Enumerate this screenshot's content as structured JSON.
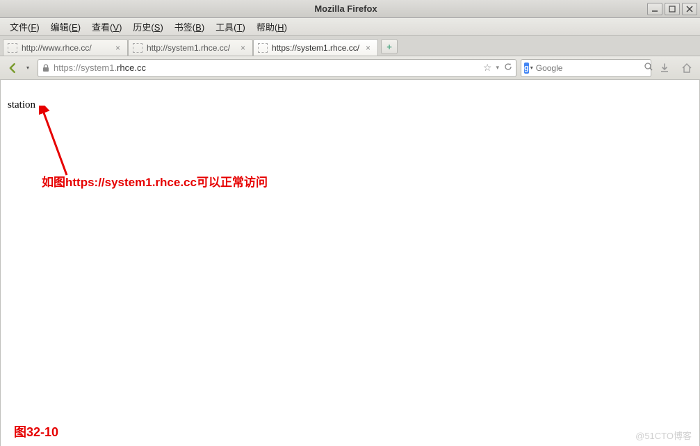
{
  "window": {
    "title": "Mozilla Firefox"
  },
  "menu": {
    "file": {
      "label": "文件",
      "accel": "F"
    },
    "edit": {
      "label": "编辑",
      "accel": "E"
    },
    "view": {
      "label": "查看",
      "accel": "V"
    },
    "history": {
      "label": "历史",
      "accel": "S"
    },
    "bookmarks": {
      "label": "书签",
      "accel": "B"
    },
    "tools": {
      "label": "工具",
      "accel": "T"
    },
    "help": {
      "label": "帮助",
      "accel": "H"
    }
  },
  "tabs": [
    {
      "label": "http://www.rhce.cc/",
      "active": false
    },
    {
      "label": "http://system1.rhce.cc/",
      "active": false
    },
    {
      "label": "https://system1.rhce.cc/",
      "active": true
    }
  ],
  "newtab_symbol": "+",
  "url": {
    "prefix": "https://",
    "domain": "system1.",
    "suffix": "rhce.cc"
  },
  "search": {
    "engine_letter": "g",
    "placeholder": "Google"
  },
  "page": {
    "body_text": "station"
  },
  "annotation": {
    "text": "如图https://system1.rhce.cc可以正常访问",
    "figure": "图32-10"
  },
  "watermark": "@51CTO博客"
}
